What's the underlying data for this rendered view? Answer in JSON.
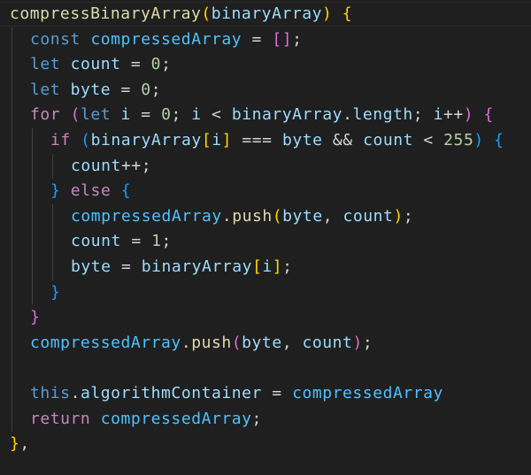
{
  "editor": {
    "theme_colors": {
      "background": "#1f1f1f",
      "keyword": "#569cd6",
      "control": "#c586c0",
      "function": "#dcdcaa",
      "variable": "#9cdcfe",
      "constant": "#4fc1ff",
      "number": "#b5cea8",
      "operator": "#d4d4d4",
      "bracket_gold": "#ffd700",
      "bracket_pink": "#da70d6",
      "bracket_blue": "#179fff",
      "indent_guide": "#404040"
    },
    "lines": [
      {
        "indent": 0,
        "tokens": [
          {
            "t": "compressBinaryArray",
            "c": "#dcdcaa"
          },
          {
            "t": "(",
            "c": "#ffd700"
          },
          {
            "t": "binaryArray",
            "c": "#9cdcfe"
          },
          {
            "t": ")",
            "c": "#ffd700"
          },
          {
            "t": " ",
            "c": "#d4d4d4"
          },
          {
            "t": "{",
            "c": "#ffd700"
          }
        ]
      },
      {
        "indent": 1,
        "tokens": [
          {
            "t": "const",
            "c": "#569cd6"
          },
          {
            "t": " ",
            "c": "#d4d4d4"
          },
          {
            "t": "compressedArray",
            "c": "#4fc1ff"
          },
          {
            "t": " = ",
            "c": "#d4d4d4"
          },
          {
            "t": "[]",
            "c": "#da70d6"
          },
          {
            "t": ";",
            "c": "#d4d4d4"
          }
        ]
      },
      {
        "indent": 1,
        "tokens": [
          {
            "t": "let",
            "c": "#569cd6"
          },
          {
            "t": " ",
            "c": "#d4d4d4"
          },
          {
            "t": "count",
            "c": "#9cdcfe"
          },
          {
            "t": " = ",
            "c": "#d4d4d4"
          },
          {
            "t": "0",
            "c": "#b5cea8"
          },
          {
            "t": ";",
            "c": "#d4d4d4"
          }
        ]
      },
      {
        "indent": 1,
        "tokens": [
          {
            "t": "let",
            "c": "#569cd6"
          },
          {
            "t": " ",
            "c": "#d4d4d4"
          },
          {
            "t": "byte",
            "c": "#9cdcfe"
          },
          {
            "t": " = ",
            "c": "#d4d4d4"
          },
          {
            "t": "0",
            "c": "#b5cea8"
          },
          {
            "t": ";",
            "c": "#d4d4d4"
          }
        ]
      },
      {
        "indent": 1,
        "tokens": [
          {
            "t": "for",
            "c": "#c586c0"
          },
          {
            "t": " ",
            "c": "#d4d4d4"
          },
          {
            "t": "(",
            "c": "#da70d6"
          },
          {
            "t": "let",
            "c": "#569cd6"
          },
          {
            "t": " ",
            "c": "#d4d4d4"
          },
          {
            "t": "i",
            "c": "#9cdcfe"
          },
          {
            "t": " = ",
            "c": "#d4d4d4"
          },
          {
            "t": "0",
            "c": "#b5cea8"
          },
          {
            "t": "; ",
            "c": "#d4d4d4"
          },
          {
            "t": "i",
            "c": "#9cdcfe"
          },
          {
            "t": " < ",
            "c": "#d4d4d4"
          },
          {
            "t": "binaryArray",
            "c": "#9cdcfe"
          },
          {
            "t": ".",
            "c": "#d4d4d4"
          },
          {
            "t": "length",
            "c": "#9cdcfe"
          },
          {
            "t": "; ",
            "c": "#d4d4d4"
          },
          {
            "t": "i",
            "c": "#9cdcfe"
          },
          {
            "t": "++",
            "c": "#d4d4d4"
          },
          {
            "t": ")",
            "c": "#da70d6"
          },
          {
            "t": " ",
            "c": "#d4d4d4"
          },
          {
            "t": "{",
            "c": "#da70d6"
          }
        ]
      },
      {
        "indent": 2,
        "tokens": [
          {
            "t": "if",
            "c": "#c586c0"
          },
          {
            "t": " ",
            "c": "#d4d4d4"
          },
          {
            "t": "(",
            "c": "#179fff"
          },
          {
            "t": "binaryArray",
            "c": "#9cdcfe"
          },
          {
            "t": "[",
            "c": "#ffd700"
          },
          {
            "t": "i",
            "c": "#9cdcfe"
          },
          {
            "t": "]",
            "c": "#ffd700"
          },
          {
            "t": " === ",
            "c": "#d4d4d4"
          },
          {
            "t": "byte",
            "c": "#9cdcfe"
          },
          {
            "t": " && ",
            "c": "#d4d4d4"
          },
          {
            "t": "count",
            "c": "#9cdcfe"
          },
          {
            "t": " < ",
            "c": "#d4d4d4"
          },
          {
            "t": "255",
            "c": "#b5cea8"
          },
          {
            "t": ")",
            "c": "#179fff"
          },
          {
            "t": " ",
            "c": "#d4d4d4"
          },
          {
            "t": "{",
            "c": "#179fff"
          }
        ]
      },
      {
        "indent": 3,
        "tokens": [
          {
            "t": "count",
            "c": "#9cdcfe"
          },
          {
            "t": "++;",
            "c": "#d4d4d4"
          }
        ]
      },
      {
        "indent": 2,
        "tokens": [
          {
            "t": "}",
            "c": "#179fff"
          },
          {
            "t": " ",
            "c": "#d4d4d4"
          },
          {
            "t": "else",
            "c": "#c586c0"
          },
          {
            "t": " ",
            "c": "#d4d4d4"
          },
          {
            "t": "{",
            "c": "#179fff"
          }
        ]
      },
      {
        "indent": 3,
        "tokens": [
          {
            "t": "compressedArray",
            "c": "#4fc1ff"
          },
          {
            "t": ".",
            "c": "#d4d4d4"
          },
          {
            "t": "push",
            "c": "#dcdcaa"
          },
          {
            "t": "(",
            "c": "#ffd700"
          },
          {
            "t": "byte",
            "c": "#9cdcfe"
          },
          {
            "t": ", ",
            "c": "#d4d4d4"
          },
          {
            "t": "count",
            "c": "#9cdcfe"
          },
          {
            "t": ")",
            "c": "#ffd700"
          },
          {
            "t": ";",
            "c": "#d4d4d4"
          }
        ]
      },
      {
        "indent": 3,
        "tokens": [
          {
            "t": "count",
            "c": "#9cdcfe"
          },
          {
            "t": " = ",
            "c": "#d4d4d4"
          },
          {
            "t": "1",
            "c": "#b5cea8"
          },
          {
            "t": ";",
            "c": "#d4d4d4"
          }
        ]
      },
      {
        "indent": 3,
        "tokens": [
          {
            "t": "byte",
            "c": "#9cdcfe"
          },
          {
            "t": " = ",
            "c": "#d4d4d4"
          },
          {
            "t": "binaryArray",
            "c": "#9cdcfe"
          },
          {
            "t": "[",
            "c": "#ffd700"
          },
          {
            "t": "i",
            "c": "#9cdcfe"
          },
          {
            "t": "]",
            "c": "#ffd700"
          },
          {
            "t": ";",
            "c": "#d4d4d4"
          }
        ]
      },
      {
        "indent": 2,
        "tokens": [
          {
            "t": "}",
            "c": "#179fff"
          }
        ]
      },
      {
        "indent": 1,
        "tokens": [
          {
            "t": "}",
            "c": "#da70d6"
          }
        ]
      },
      {
        "indent": 1,
        "tokens": [
          {
            "t": "compressedArray",
            "c": "#4fc1ff"
          },
          {
            "t": ".",
            "c": "#d4d4d4"
          },
          {
            "t": "push",
            "c": "#dcdcaa"
          },
          {
            "t": "(",
            "c": "#da70d6"
          },
          {
            "t": "byte",
            "c": "#9cdcfe"
          },
          {
            "t": ", ",
            "c": "#d4d4d4"
          },
          {
            "t": "count",
            "c": "#9cdcfe"
          },
          {
            "t": ")",
            "c": "#da70d6"
          },
          {
            "t": ";",
            "c": "#d4d4d4"
          }
        ]
      },
      {
        "indent": 1,
        "tokens": []
      },
      {
        "indent": 1,
        "tokens": [
          {
            "t": "this",
            "c": "#569cd6"
          },
          {
            "t": ".",
            "c": "#d4d4d4"
          },
          {
            "t": "algorithmContainer",
            "c": "#9cdcfe"
          },
          {
            "t": " = ",
            "c": "#d4d4d4"
          },
          {
            "t": "compressedArray",
            "c": "#4fc1ff"
          }
        ]
      },
      {
        "indent": 1,
        "tokens": [
          {
            "t": "return",
            "c": "#c586c0"
          },
          {
            "t": " ",
            "c": "#d4d4d4"
          },
          {
            "t": "compressedArray",
            "c": "#4fc1ff"
          },
          {
            "t": ";",
            "c": "#d4d4d4"
          }
        ]
      },
      {
        "indent": 0,
        "tokens": [
          {
            "t": "}",
            "c": "#ffd700"
          },
          {
            "t": ",",
            "c": "#d4d4d4"
          }
        ]
      }
    ]
  }
}
